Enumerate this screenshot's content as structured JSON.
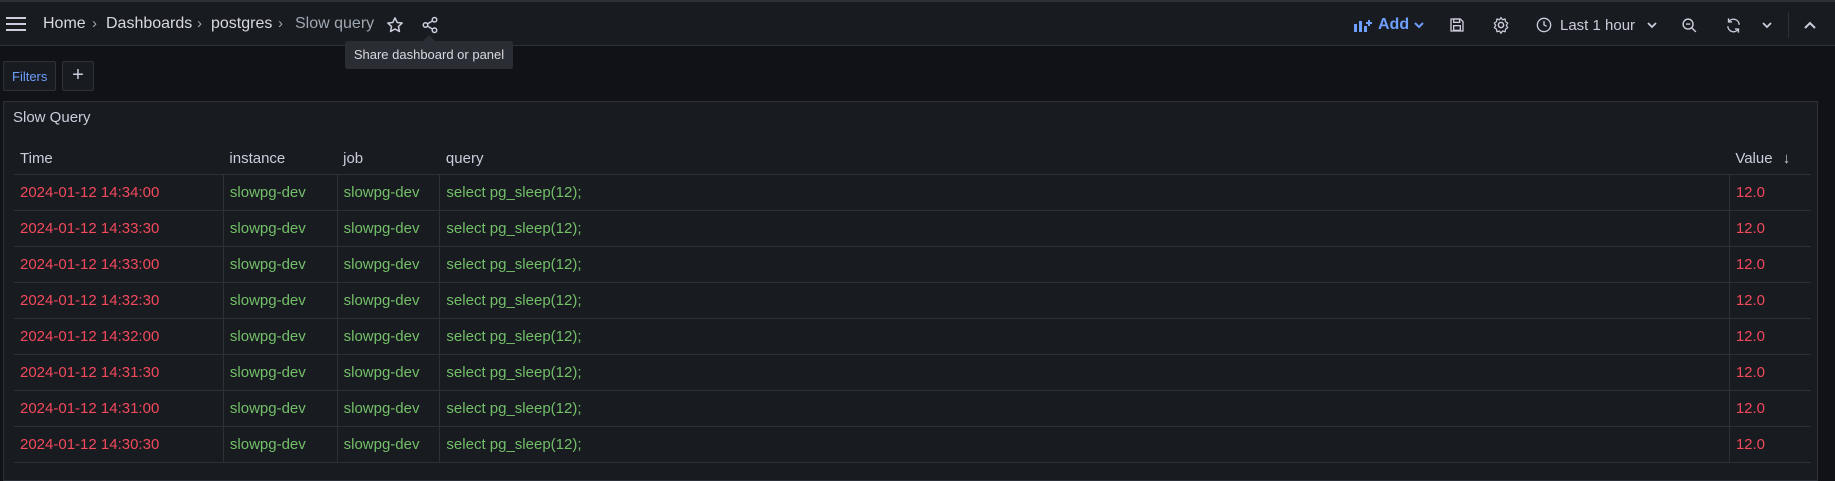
{
  "breadcrumbs": [
    {
      "label": "Home"
    },
    {
      "label": "Dashboards"
    },
    {
      "label": "postgres"
    },
    {
      "label": "Slow query"
    }
  ],
  "breadcrumb_separator": "›",
  "tooltip": "Share dashboard or panel",
  "toolbar": {
    "add_label": "Add",
    "time_range": "Last 1 hour"
  },
  "filters": {
    "label": "Filters",
    "add_label": "+"
  },
  "panel": {
    "title": "Slow Query",
    "columns": [
      "Time",
      "instance",
      "job",
      "query",
      "Value"
    ],
    "sort_indicator": "↓",
    "rows": [
      [
        "2024-01-12 14:34:00",
        "slowpg-dev",
        "slowpg-dev",
        "select pg_sleep(12);",
        "12.0"
      ],
      [
        "2024-01-12 14:33:30",
        "slowpg-dev",
        "slowpg-dev",
        "select pg_sleep(12);",
        "12.0"
      ],
      [
        "2024-01-12 14:33:00",
        "slowpg-dev",
        "slowpg-dev",
        "select pg_sleep(12);",
        "12.0"
      ],
      [
        "2024-01-12 14:32:30",
        "slowpg-dev",
        "slowpg-dev",
        "select pg_sleep(12);",
        "12.0"
      ],
      [
        "2024-01-12 14:32:00",
        "slowpg-dev",
        "slowpg-dev",
        "select pg_sleep(12);",
        "12.0"
      ],
      [
        "2024-01-12 14:31:30",
        "slowpg-dev",
        "slowpg-dev",
        "select pg_sleep(12);",
        "12.0"
      ],
      [
        "2024-01-12 14:31:00",
        "slowpg-dev",
        "slowpg-dev",
        "select pg_sleep(12);",
        "12.0"
      ],
      [
        "2024-01-12 14:30:30",
        "slowpg-dev",
        "slowpg-dev",
        "select pg_sleep(12);",
        "12.0"
      ]
    ]
  },
  "colors": {
    "background": "#111217",
    "panel": "#181b1f",
    "accent_blue": "#6e9fff",
    "value_red": "#f2495c",
    "label_green": "#73bf69"
  },
  "icons": [
    "menu-icon",
    "star-icon",
    "share-icon",
    "add-panel-icon",
    "chevron-down-icon",
    "save-icon",
    "gear-icon",
    "clock-icon",
    "zoom-out-icon",
    "refresh-icon",
    "collapse-icon"
  ]
}
